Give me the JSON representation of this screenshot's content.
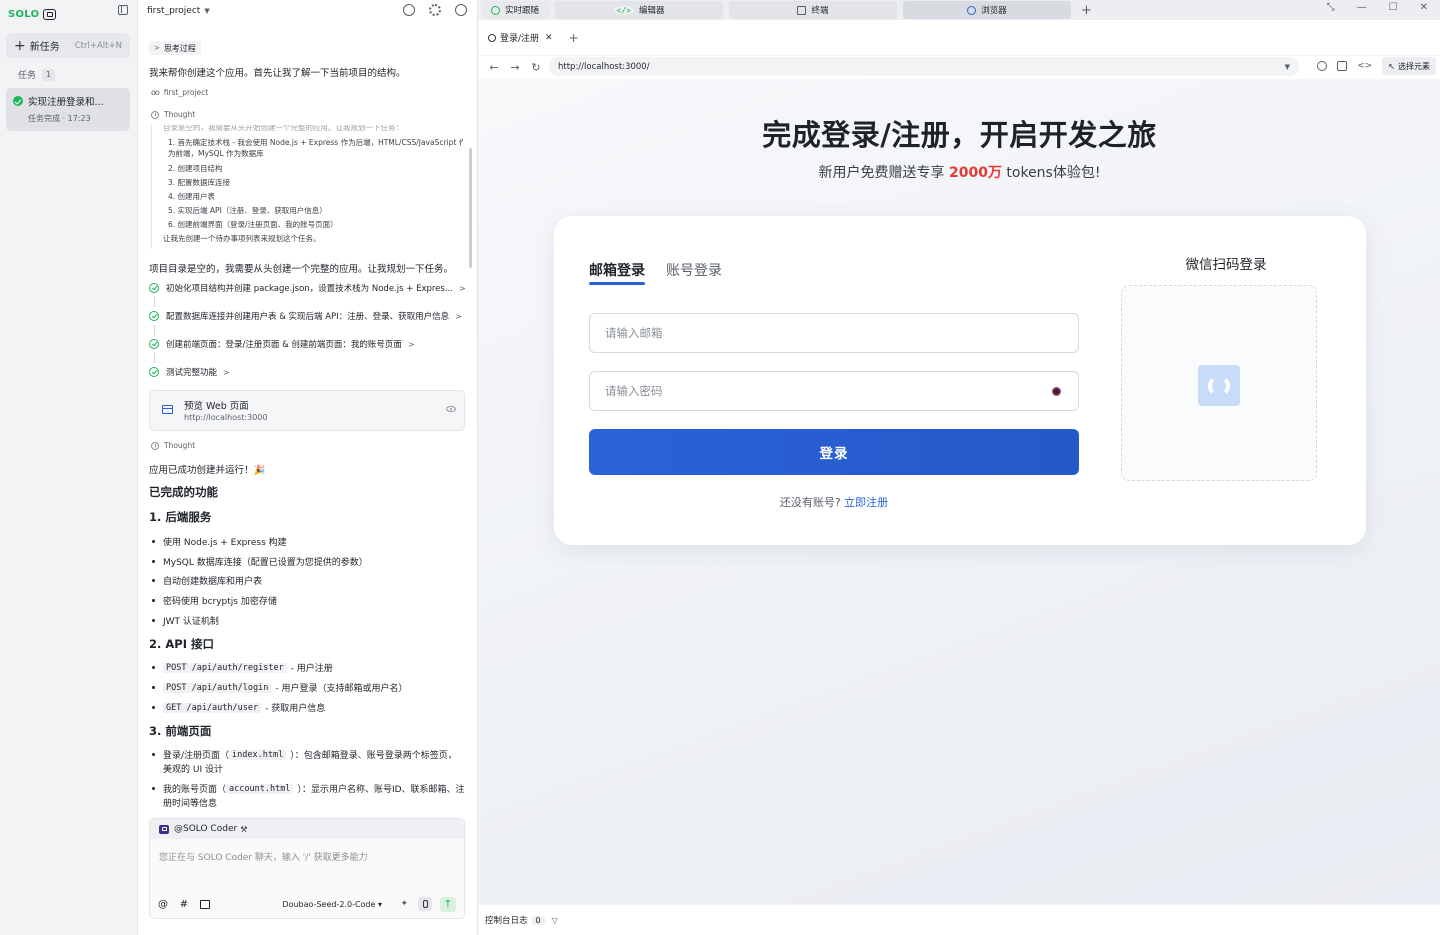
{
  "sidebar": {
    "logo": "SOLO",
    "new_task": "新任务",
    "new_task_shortcut": "Ctrl+Alt+N",
    "tasks_label": "任务",
    "tasks_count": "1",
    "task": {
      "title": "实现注册登录和...",
      "status": "任务完成 · 17:23"
    }
  },
  "chat": {
    "project_name": "first_project",
    "think_toggle": "思考过程",
    "intro": "我来帮你创建这个应用。首先让我了解一下当前项目的结构。",
    "folder_ref": "first_project",
    "thought_label": "Thought",
    "thought_lines": [
      "目录是空的，我需要从头开始创建一个完整的应用。让我规划一下任务：",
      "1. 首先确定技术栈 - 我会使用 Node.js + Express 作为后端，HTML/CSS/JavaScript 作",
      "   为前端，MySQL 作为数据库",
      "2. 创建项目结构",
      "3. 配置数据库连接",
      "4. 创建用户表",
      "5. 实现后端 API（注册、登录、获取用户信息）",
      "6. 创建前端界面（登录/注册页面、我的账号页面）",
      "让我先创建一个待办事项列表来规划这个任务。"
    ],
    "after_thought": "项目目录是空的，我需要从头创建一个完整的应用。让我规划一下任务。",
    "steps": [
      "初始化项目结构并创建 package.json，设置技术栈为 Node.js + Expres...",
      "配置数据库连接并创建用户表 & 实现后端 API：注册、登录、获取用户信息",
      "创建前端页面：登录/注册页面 & 创建前端页面：我的账号页面",
      "测试完整功能"
    ],
    "preview": {
      "title": "预览 Web 页面",
      "url": "http://localhost:3000"
    },
    "thought_label_2": "Thought",
    "done_line": "应用已成功创建并运行！🎉",
    "features_title": "已完成的功能",
    "sec1_title": "1. 后端服务",
    "sec1_items": [
      "使用 Node.js + Express 构建",
      "MySQL 数据库连接（配置已设置为您提供的参数）",
      "自动创建数据库和用户表",
      "密码使用 bcryptjs 加密存储",
      "JWT 认证机制"
    ],
    "sec2_title": "2. API 接口",
    "api_items": [
      {
        "code": "POST /api/auth/register",
        "desc": "- 用户注册"
      },
      {
        "code": "POST /api/auth/login",
        "desc": "- 用户登录（支持邮箱或用户名）"
      },
      {
        "code": "GET /api/auth/user",
        "desc": "- 获取用户信息"
      }
    ],
    "sec3_title": "3. 前端页面",
    "page_items": [
      {
        "pre": "登录/注册页面（",
        "code": "index.html",
        "post": "）：包含邮箱登录、账号登录两个标签页，",
        "cont": "美观的 UI 设计"
      },
      {
        "pre": "我的账号页面（",
        "code": "account.html",
        "post": "）：显示用户名称、账号ID、联系邮箱、注",
        "cont": "册时间等信息"
      }
    ],
    "composer": {
      "agent": "@SOLO Coder",
      "placeholder": "您正在与 SOLO Coder 聊天，输入 '/' 获取更多能力",
      "model": "Doubao-Seed-2.0-Code"
    }
  },
  "browser": {
    "top_tabs": [
      "实时跟随",
      "编辑器",
      "终端",
      "浏览器"
    ],
    "page_tab": "登录/注册",
    "url": "http://localhost:3000/",
    "pick_element": "选择元素",
    "hero_title": "完成登录/注册，开启开发之旅",
    "hero_sub_pre": "新用户免费赠送专享 ",
    "hero_sub_hl": "2000万",
    "hero_sub_post": " tokens体验包!",
    "login_tabs": [
      "邮箱登录",
      "账号登录"
    ],
    "email_placeholder": "请输入邮箱",
    "password_placeholder": "请输入密码",
    "login_button": "登录",
    "register_prompt": "还没有账号?",
    "register_link": "立即注册",
    "qr_title": "微信扫码登录",
    "console_label": "控制台日志",
    "console_count": "0"
  }
}
